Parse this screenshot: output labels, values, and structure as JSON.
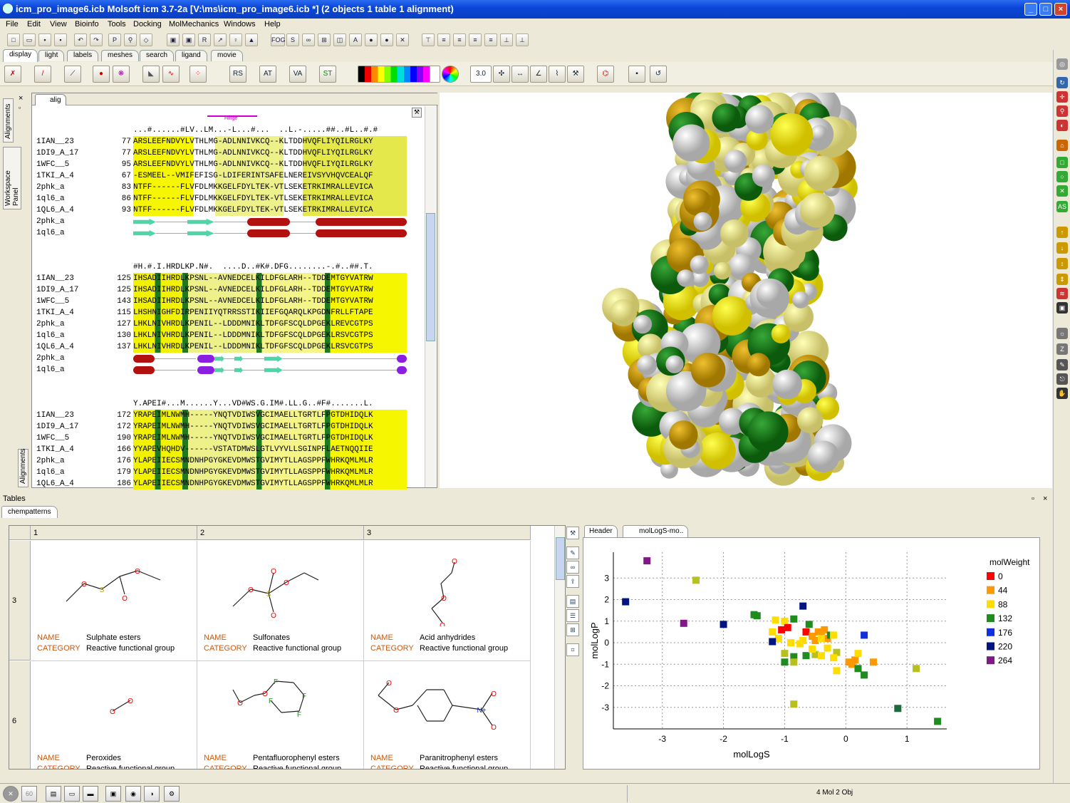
{
  "window": {
    "title": "icm_pro_image6.icb Molsoft icm 3.7-2a  [V:\\ms\\icm_pro_image6.icb *] (2 objects 1 table 1 alignment)"
  },
  "menu": [
    "File",
    "Edit",
    "View",
    "Bioinfo",
    "Tools",
    "Docking",
    "MolMechanics",
    "Windows",
    "Help"
  ],
  "panel_tabs": [
    "display",
    "light",
    "labels",
    "meshes",
    "search",
    "ligand",
    "movie"
  ],
  "toolbar1_labels": {
    "fog": "FOG",
    "t3": "3.0"
  },
  "left_tabs": {
    "alignments": "Alignments",
    "workspace": "Workspace Panel",
    "alignments2": "Alignments"
  },
  "alignment": {
    "tab": "alig",
    "hinge_label": "Hinge",
    "blocks": [
      {
        "consensus": "...#......#LV..LM...-L...#...  ..L.-.....##..#L..#.#",
        "rows": [
          {
            "name": "1IAN__23",
            "num": "77",
            "seq": "ARSLEEFNDVYLVTHLMG-ADLNNIVKCQ--KLTDDHVQFLIYQILRGLKY"
          },
          {
            "name": "1DI9_A_17",
            "num": "77",
            "seq": "ARSLEEFNDVYLVTHLMG-ADLNNIVKCQ--KLTDDHVQFLIYQILRGLKY"
          },
          {
            "name": "1WFC__5",
            "num": "95",
            "seq": "ARSLEEFNDVYLVTHLMG-ADLNNIVKCQ--KLTDDHVQFLIYQILRGLKY"
          },
          {
            "name": "1TKI_A_4",
            "num": "67",
            "seq": "-ESMEEL--VMIFEFISG-LDIFERINTSAFELNEREIVSYVHQVCEALQF"
          },
          {
            "name": "2phk_a",
            "num": "83",
            "seq": "NTFF------FLVFDLMKKGELFDYLTEK-VTLSEKETRKIMRALLEVICA"
          },
          {
            "name": "1ql6_a",
            "num": "86",
            "seq": "NTFF------FLVFDLMKKGELFDYLTEK-VTLSEKETRKIMRALLEVICA"
          },
          {
            "name": "1QL6_A_4",
            "num": "93",
            "seq": "NTFF------FLVFDLMKKGELFDYLTEK-VTLSEKETRKIMRALLEVICA"
          }
        ],
        "ss": [
          {
            "name": "2phk_a"
          },
          {
            "name": "1ql6_a"
          }
        ]
      },
      {
        "consensus": "#H.#.I.HRDLKP.N#.  ....D..#K#.DFG........-.#..##.T.",
        "rows": [
          {
            "name": "1IAN__23",
            "num": "125",
            "seq": "IHSADIIHRDLKPSNL--AVNEDCELKILDFGLARH--TDDEMTGYVATRW"
          },
          {
            "name": "1DI9_A_17",
            "num": "125",
            "seq": "IHSADIIHRDLKPSNL--AVNEDCELKILDFGLARH--TDDEMTGYVATRW"
          },
          {
            "name": "1WFC__5",
            "num": "143",
            "seq": "IHSADIIHRDLKPSNL--AVNEDCELKILDFGLARH--TDDEMTGYVATRW"
          },
          {
            "name": "1TKI_A_4",
            "num": "115",
            "seq": "LHSHNIGHFDIRPENIIYQTRRSSTIKIIEFGQARQLKPGDNFRLLFTAPE"
          },
          {
            "name": "2phk_a",
            "num": "127",
            "seq": "LHKLNIVHRDLKPENIL--LDDDMNIKLTDFGFSCQLDPGEKLREVCGTPS"
          },
          {
            "name": "1ql6_a",
            "num": "130",
            "seq": "LHKLNIVHRDLKPENIL--LDDDMNIKLTDFGFSCQLDPGEKLRSVCGTPS"
          },
          {
            "name": "1QL6_A_4",
            "num": "137",
            "seq": "LHKLNIVHRDLKPENIL--LDDDMNIKLTDFGFSCQLDPGEKLRSVCGTPS"
          }
        ],
        "ss": [
          {
            "name": "2phk_a"
          },
          {
            "name": "1ql6_a"
          }
        ]
      },
      {
        "consensus": "Y.APEI#...M......Y...VD#WS.G.IM#.LL.G..#F#.......L.",
        "rows": [
          {
            "name": "1IAN__23",
            "num": "172",
            "seq": "YRAPEIMLNWMH-----YNQTVDIWSVGCIMAELLTGRTLFPGTDHIDQLK"
          },
          {
            "name": "1DI9_A_17",
            "num": "172",
            "seq": "YRAPEIMLNWMH-----YNQTVDIWSVGCIMAELLTGRTLFPGTDHIDQLK"
          },
          {
            "name": "1WFC__5",
            "num": "190",
            "seq": "YRAPEIMLNWMH-----YNQTVDIWSVGCIMAELLTGRTLFPGTDHIDQLK"
          },
          {
            "name": "1TKI_A_4",
            "num": "166",
            "seq": "YYAPEVHQHDV------VSTATDMWSLGTLVYVLLSGINPFLAETNQQIIE"
          },
          {
            "name": "2phk_a",
            "num": "176",
            "seq": "YLAPEIIECSMNDNHPGYGKEVDMWSTGVIMYTLLAGSPPFWHRKQMLMLR"
          },
          {
            "name": "1ql6_a",
            "num": "179",
            "seq": "YLAPEIIECSMNDNHPGYGKEVDMWSTGVIMYTLLAGSPPFWHRKQMLMLR"
          },
          {
            "name": "1QL6_A_4",
            "num": "186",
            "seq": "YLAPEIIECSMNDNHPGYGKEVDMWSTGVIMYTLLAGSPPFWHRKQMLMLR"
          }
        ]
      }
    ]
  },
  "tables": {
    "label": "Tables",
    "tab": "chempatterns",
    "columns": [
      "1",
      "2",
      "3"
    ],
    "row_headers": [
      "3",
      "6"
    ],
    "keys": {
      "name": "NAME",
      "category": "CATEGORY"
    },
    "cells": [
      {
        "name": "Sulphate esters",
        "category": "Reactive functional group"
      },
      {
        "name": "Sulfonates",
        "category": "Reactive functional group"
      },
      {
        "name": "Acid anhydrides",
        "category": "Reactive functional group"
      },
      {
        "name": "Peroxides",
        "category": "Reactive functional group"
      },
      {
        "name": "Pentafluorophenyl esters",
        "category": "Reactive functional group"
      },
      {
        "name": "Paranitrophenyl esters",
        "category": "Reactive functional group"
      }
    ],
    "atom_labels": {
      "o": "O",
      "s": "S",
      "f": "F",
      "n": "N+"
    }
  },
  "plot_tabs": {
    "header": "Header",
    "plot": "molLogS-mo.."
  },
  "chart_data": {
    "type": "scatter",
    "xlabel": "molLogS",
    "ylabel": "molLogP",
    "xlim": [
      -3.8,
      1.65
    ],
    "ylim": [
      -4.0,
      4.2
    ],
    "xticks": [
      -3,
      -2,
      -1,
      0,
      1
    ],
    "yticks": [
      -3,
      -2,
      -1,
      0,
      1,
      2,
      3
    ],
    "grid": true,
    "legend": {
      "title": "molWeight",
      "placement": "right",
      "entries": [
        {
          "label": "0",
          "color": "#ff0000"
        },
        {
          "label": "44",
          "color": "#ff9900"
        },
        {
          "label": "88",
          "color": "#ffdd00"
        },
        {
          "label": "132",
          "color": "#1e8c1e"
        },
        {
          "label": "176",
          "color": "#1030e0"
        },
        {
          "label": "220",
          "color": "#001580"
        },
        {
          "label": "264",
          "color": "#801888"
        }
      ]
    },
    "points": [
      {
        "x": -3.25,
        "y": 3.8,
        "c": "#801888"
      },
      {
        "x": -2.45,
        "y": 2.9,
        "c": "#b8c020"
      },
      {
        "x": -3.6,
        "y": 1.9,
        "c": "#001580"
      },
      {
        "x": -2.65,
        "y": 0.9,
        "c": "#801888"
      },
      {
        "x": -2.0,
        "y": 0.85,
        "c": "#001580"
      },
      {
        "x": -1.45,
        "y": 1.25,
        "c": "#1e8c1e"
      },
      {
        "x": -1.5,
        "y": 1.3,
        "c": "#1e8c1e"
      },
      {
        "x": -0.7,
        "y": 1.7,
        "c": "#001580"
      },
      {
        "x": -1.15,
        "y": 1.05,
        "c": "#ffdd00"
      },
      {
        "x": -1.0,
        "y": 1.0,
        "c": "#ffdd00"
      },
      {
        "x": -0.85,
        "y": 1.1,
        "c": "#1e8c1e"
      },
      {
        "x": -1.05,
        "y": 0.6,
        "c": "#ff0000"
      },
      {
        "x": -0.95,
        "y": 0.7,
        "c": "#ff0000"
      },
      {
        "x": -0.65,
        "y": 0.5,
        "c": "#ff0000"
      },
      {
        "x": -0.6,
        "y": 0.85,
        "c": "#1e8c1e"
      },
      {
        "x": -0.55,
        "y": 0.3,
        "c": "#ff9900"
      },
      {
        "x": -0.45,
        "y": 0.5,
        "c": "#ff9900"
      },
      {
        "x": -0.4,
        "y": 0.4,
        "c": "#ff9900"
      },
      {
        "x": -0.35,
        "y": 0.6,
        "c": "#ff9900"
      },
      {
        "x": -0.3,
        "y": 0.2,
        "c": "#ff9900"
      },
      {
        "x": -0.25,
        "y": 0.35,
        "c": "#1e8c1e"
      },
      {
        "x": -0.2,
        "y": 0.35,
        "c": "#ffdd00"
      },
      {
        "x": -1.2,
        "y": 0.5,
        "c": "#ffdd00"
      },
      {
        "x": -1.1,
        "y": 0.2,
        "c": "#ffdd00"
      },
      {
        "x": -1.2,
        "y": 0.05,
        "c": "#001580"
      },
      {
        "x": -0.9,
        "y": 0.0,
        "c": "#ffdd00"
      },
      {
        "x": -0.75,
        "y": -0.05,
        "c": "#ffdd00"
      },
      {
        "x": -0.7,
        "y": 0.1,
        "c": "#ffdd00"
      },
      {
        "x": -0.5,
        "y": 0.1,
        "c": "#ff9900"
      },
      {
        "x": -0.3,
        "y": -0.25,
        "c": "#ffdd00"
      },
      {
        "x": -0.15,
        "y": -0.45,
        "c": "#b8c020"
      },
      {
        "x": -1.0,
        "y": -0.5,
        "c": "#b8c020"
      },
      {
        "x": -0.85,
        "y": -0.65,
        "c": "#1e8c1e"
      },
      {
        "x": -0.65,
        "y": -0.6,
        "c": "#1e8c1e"
      },
      {
        "x": -0.5,
        "y": -0.55,
        "c": "#b8c020"
      },
      {
        "x": -0.4,
        "y": -0.6,
        "c": "#ffdd00"
      },
      {
        "x": -0.2,
        "y": -0.7,
        "c": "#ffdd00"
      },
      {
        "x": -0.85,
        "y": -0.9,
        "c": "#b8c020"
      },
      {
        "x": -1.0,
        "y": -0.9,
        "c": "#1e8c1e"
      },
      {
        "x": -0.15,
        "y": -1.3,
        "c": "#ffdd00"
      },
      {
        "x": 0.1,
        "y": -1.0,
        "c": "#ff9900"
      },
      {
        "x": 0.15,
        "y": -0.8,
        "c": "#ff9900"
      },
      {
        "x": 0.2,
        "y": -0.5,
        "c": "#ffdd00"
      },
      {
        "x": 0.2,
        "y": -1.2,
        "c": "#1e8c1e"
      },
      {
        "x": 0.3,
        "y": -1.5,
        "c": "#1e8c1e"
      },
      {
        "x": 0.3,
        "y": 0.35,
        "c": "#1030e0"
      },
      {
        "x": 0.45,
        "y": -0.9,
        "c": "#ff9900"
      },
      {
        "x": 1.15,
        "y": -1.2,
        "c": "#b8c020"
      },
      {
        "x": -0.85,
        "y": -2.85,
        "c": "#b8c020"
      },
      {
        "x": 0.85,
        "y": -3.05,
        "c": "#1e6a3e"
      },
      {
        "x": 1.5,
        "y": -3.65,
        "c": "#1e8c1e"
      },
      {
        "x": -0.4,
        "y": 0.2,
        "c": "#ffdd00"
      },
      {
        "x": -0.55,
        "y": -0.3,
        "c": "#ffdd00"
      },
      {
        "x": 0.05,
        "y": -0.9,
        "c": "#ff9900"
      }
    ]
  },
  "statusbar": {
    "objects": "4 Mol 2 Obj",
    "sixty": "60"
  },
  "icons": [
    "close-icon",
    "maximize-icon",
    "minimize-icon",
    "gear-icon",
    "wrench-icon"
  ]
}
